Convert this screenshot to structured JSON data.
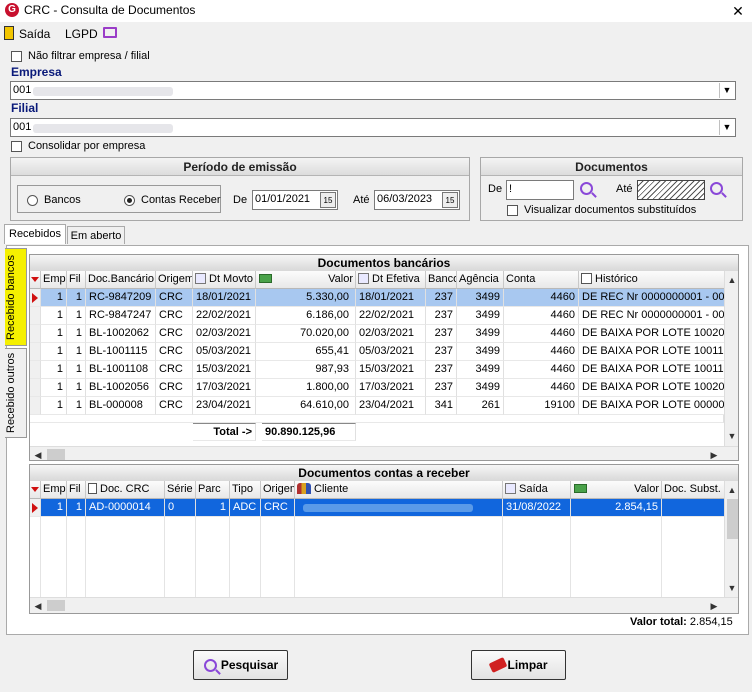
{
  "window": {
    "title": "CRC - Consulta de Documentos",
    "close_symbol": "✕"
  },
  "menu": {
    "saida": "Saída",
    "lgpd": "LGPD"
  },
  "filters": {
    "nao_filtrar": "Não filtrar empresa / filial",
    "empresa_label": "Empresa",
    "empresa_value": "001",
    "filial_label": "Filial",
    "filial_value": "001",
    "consolidar": "Consolidar por empresa"
  },
  "periodo": {
    "title": "Período de emissão",
    "radio_bancos": "Bancos",
    "radio_contas": "Contas Receber",
    "de_label": "De",
    "de_value": "01/01/2021",
    "ate_label": "Até",
    "ate_value": "06/03/2023",
    "date_btn": "15"
  },
  "documentos": {
    "title": "Documentos",
    "de_label": "De",
    "de_value": "!",
    "ate_label": "Até",
    "visualizar": "Visualizar documentos substituídos"
  },
  "tabs": {
    "recebidos": "Recebidos",
    "em_aberto": "Em aberto"
  },
  "vtabs": {
    "bancos": "Recebido bancos",
    "outros": "Recebido outros"
  },
  "grid_bancos": {
    "title": "Documentos bancários",
    "headers": [
      "Emp",
      "Fil",
      "Doc.Bancário",
      "Origem",
      "Dt Movto",
      "Valor",
      "Dt Efetiva",
      "Banco",
      "Agência",
      "Conta",
      "Histórico"
    ],
    "rows": [
      [
        "1",
        "1",
        "RC-9847209",
        "CRC",
        "18/01/2021",
        "5.330,00",
        "18/01/2021",
        "237",
        "3499",
        "4460",
        "DE REC Nr 0000000001 - 00"
      ],
      [
        "1",
        "1",
        "RC-9847247",
        "CRC",
        "22/02/2021",
        "6.186,00",
        "22/02/2021",
        "237",
        "3499",
        "4460",
        "DE REC Nr 0000000001 - 00"
      ],
      [
        "1",
        "1",
        "BL-1002062",
        "CRC",
        "02/03/2021",
        "70.020,00",
        "02/03/2021",
        "237",
        "3499",
        "4460",
        "DE BAIXA POR LOTE 10020"
      ],
      [
        "1",
        "1",
        "BL-1001115",
        "CRC",
        "05/03/2021",
        "655,41",
        "05/03/2021",
        "237",
        "3499",
        "4460",
        "DE BAIXA POR LOTE 10011"
      ],
      [
        "1",
        "1",
        "BL-1001108",
        "CRC",
        "15/03/2021",
        "987,93",
        "15/03/2021",
        "237",
        "3499",
        "4460",
        "DE BAIXA POR LOTE 10011"
      ],
      [
        "1",
        "1",
        "BL-1002056",
        "CRC",
        "17/03/2021",
        "1.800,00",
        "17/03/2021",
        "237",
        "3499",
        "4460",
        "DE BAIXA POR LOTE 10020"
      ],
      [
        "1",
        "1",
        "BL-000008",
        "CRC",
        "23/04/2021",
        "64.610,00",
        "23/04/2021",
        "341",
        "261",
        "19100",
        "DE BAIXA POR LOTE 00000"
      ]
    ],
    "total_label": "Total ->",
    "total_value": "90.890.125,96"
  },
  "grid_contas": {
    "title": "Documentos contas a receber",
    "headers": [
      "Emp",
      "Fil",
      "Doc. CRC",
      "Série",
      "Parc",
      "Tipo",
      "Origem",
      "Cliente",
      "Saída",
      "Valor",
      "Doc. Subst."
    ],
    "rows": [
      [
        "1",
        "1",
        "AD-0000014",
        "0",
        "1",
        "ADC",
        "CRC",
        "",
        "31/08/2022",
        "2.854,15",
        ""
      ]
    ],
    "valor_total_label": "Valor total:",
    "valor_total_value": "2.854,15"
  },
  "buttons": {
    "pesquisar": "Pesquisar",
    "limpar": "Limpar"
  },
  "colors": {
    "accent_blue": "#0a1a7a",
    "selection": "#1166dd",
    "row_indicator": "#d01010"
  }
}
